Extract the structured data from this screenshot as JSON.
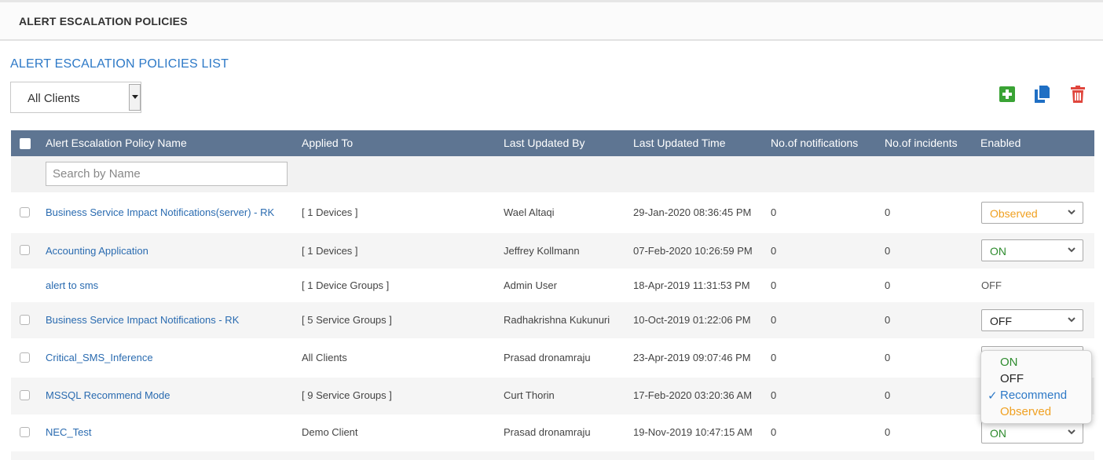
{
  "header": {
    "title": "ALERT ESCALATION POLICIES"
  },
  "list": {
    "title": "ALERT ESCALATION POLICIES  LIST"
  },
  "client_filter": {
    "value": "All Clients"
  },
  "toolbar": {
    "add_icon": "plus-square-icon",
    "copy_icon": "copy-icon",
    "delete_icon": "trash-icon"
  },
  "table": {
    "columns": {
      "name": "Alert Escalation Policy Name",
      "applied_to": "Applied To",
      "updated_by": "Last Updated By",
      "updated_time": "Last Updated Time",
      "notifications": "No.of notifications",
      "incidents": "No.of incidents",
      "enabled": "Enabled"
    },
    "search_placeholder": "Search by Name",
    "rows": [
      {
        "name": "Business Service Impact Notifications(server) - RK",
        "applied_to": "[ 1 Devices ]",
        "updated_by": "Wael Altaqi",
        "updated_time": "29-Jan-2020 08:36:45 PM",
        "notifications": "0",
        "incidents": "0",
        "enabled": "Observed"
      },
      {
        "name": "Accounting Application",
        "applied_to": "[ 1 Devices ]",
        "updated_by": "Jeffrey Kollmann",
        "updated_time": "07-Feb-2020 10:26:59 PM",
        "notifications": "0",
        "incidents": "0",
        "enabled": "ON"
      },
      {
        "name": "alert to sms",
        "applied_to": "[ 1 Device Groups ]",
        "updated_by": "Admin User",
        "updated_time": "18-Apr-2019 11:31:53 PM",
        "notifications": "0",
        "incidents": "0",
        "enabled": "OFF"
      },
      {
        "name": "Business Service Impact Notifications - RK",
        "applied_to": "[ 5 Service Groups ]",
        "updated_by": "Radhakrishna Kukunuri",
        "updated_time": "10-Oct-2019 01:22:06 PM",
        "notifications": "0",
        "incidents": "0",
        "enabled": "OFF"
      },
      {
        "name": "Critical_SMS_Inference",
        "applied_to": "All Clients",
        "updated_by": "Prasad dronamraju",
        "updated_time": "23-Apr-2019 09:07:46 PM",
        "notifications": "0",
        "incidents": "0",
        "enabled": ""
      },
      {
        "name": "MSSQL Recommend Mode",
        "applied_to": "[ 9 Service Groups ]",
        "updated_by": "Curt Thorin",
        "updated_time": "17-Feb-2020 03:20:36 AM",
        "notifications": "0",
        "incidents": "0",
        "enabled": ""
      },
      {
        "name": "NEC_Test",
        "applied_to": "Demo Client",
        "updated_by": "Prasad dronamraju",
        "updated_time": "19-Nov-2019 10:47:15 AM",
        "notifications": "0",
        "incidents": "0",
        "enabled": "ON"
      }
    ]
  },
  "enabled_dropdown": {
    "options": [
      "ON",
      "OFF",
      "Recommend",
      "Observed"
    ],
    "selected": "Recommend",
    "check_mark": "✓"
  },
  "colors": {
    "accent": "#2d79c7",
    "header_bg": "#5e7592",
    "on": "#2e8b2e",
    "off": "#222222",
    "observed": "#f0a020",
    "add": "#3aa335",
    "copy": "#1f6fc4",
    "delete": "#e0463d"
  }
}
